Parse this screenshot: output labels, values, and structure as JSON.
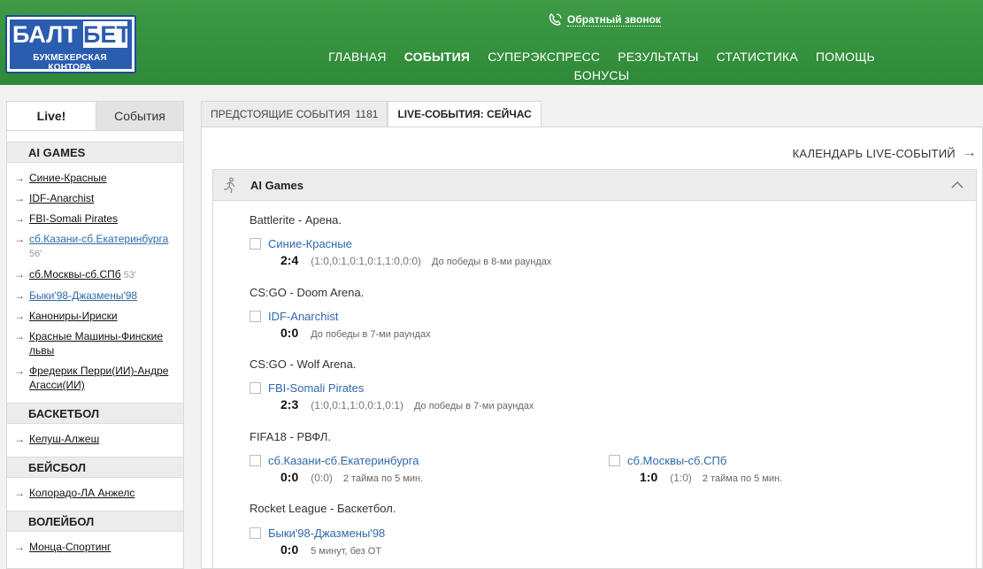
{
  "header": {
    "logo_main": "БАЛТ",
    "logo_bet": "БЕТ",
    "logo_sub": "БУКМЕКЕРСКАЯ КОНТОРА",
    "callback": "Обратный звонок",
    "nav": [
      "ГЛАВНАЯ",
      "СОБЫТИЯ",
      "СУПЕРЭКСПРЕСС",
      "РЕЗУЛЬТАТЫ",
      "СТАТИСТИКА",
      "ПОМОЩЬ"
    ],
    "nav_row2": "БОНУСЫ",
    "active_nav": "СОБЫТИЯ"
  },
  "sidebar": {
    "tab_live": "Live!",
    "tab_events": "События",
    "sections": [
      {
        "title": "AI GAMES",
        "items": [
          {
            "label": "Синие-Красные"
          },
          {
            "label": "IDF-Anarchist"
          },
          {
            "label": "FBI-Somali Pirates"
          },
          {
            "label": "сб.Казани-сб.Екатеринбурга",
            "time": "56'",
            "blue": true
          },
          {
            "label": "сб.Москвы-сб.СПб",
            "time": "53'"
          },
          {
            "label": "Быки'98-Джазмены'98",
            "blue": true
          },
          {
            "label": "Канониры-Ириски"
          },
          {
            "label": "Красные Машины-Финские львы"
          },
          {
            "label": "Фредерик Перри(ИИ)-Андре Агасси(ИИ)"
          }
        ]
      },
      {
        "title": "БАСКЕТБОЛ",
        "items": [
          {
            "label": "Келуш-Алжеш"
          }
        ]
      },
      {
        "title": "БЕЙСБОЛ",
        "items": [
          {
            "label": "Колорадо-ЛА Анжелс"
          }
        ]
      },
      {
        "title": "ВОЛЕЙБОЛ",
        "items": [
          {
            "label": "Монца-Спортинг"
          }
        ]
      }
    ]
  },
  "main": {
    "tab_upcoming": "ПРЕДСТОЯЩИЕ СОБЫТИЯ",
    "tab_upcoming_count": "1181",
    "tab_live": "LIVE-СОБЫТИЯ: СЕЙЧАС",
    "calendar": "КАЛЕНДАРЬ LIVE-СОБЫТИЙ",
    "group_title": "AI Games",
    "leagues": [
      {
        "name": "Battlerite - Арена.",
        "events": [
          {
            "name": "Синие-Красные",
            "score": "2:4",
            "detail": "(1:0,0:1,0:1,0:1,1:0,0:0)",
            "note": "До победы в 8-ми раундах"
          }
        ]
      },
      {
        "name": "CS:GO - Doom Arena.",
        "events": [
          {
            "name": "IDF-Anarchist",
            "score": "0:0",
            "detail": "",
            "note": "До победы в 7-ми раундах"
          }
        ]
      },
      {
        "name": "CS:GO - Wolf Arena.",
        "events": [
          {
            "name": "FBI-Somali Pirates",
            "score": "2:3",
            "detail": "(1:0,0:1,1:0,0:1,0:1)",
            "note": "До победы в 7-ми раундах"
          }
        ]
      },
      {
        "name": "FIFA18 - РВФЛ.",
        "events": [
          {
            "name": "сб.Казани-сб.Екатеринбурга",
            "score": "0:0",
            "detail": "(0:0)",
            "note": "2 тайма по 5 мин."
          },
          {
            "name": "сб.Москвы-сб.СПб",
            "score": "1:0",
            "detail": "(1:0)",
            "note": "2 тайма по 5 мин."
          }
        ]
      },
      {
        "name": "Rocket League - Баскетбол.",
        "events": [
          {
            "name": "Быки'98-Джазмены'98",
            "score": "0:0",
            "detail": "",
            "note": "5 минут, без ОТ"
          }
        ]
      }
    ]
  },
  "colors": {
    "header_green": "#2e8a38",
    "logo_blue": "#2a5db0",
    "link_blue": "#2f6aa8"
  }
}
